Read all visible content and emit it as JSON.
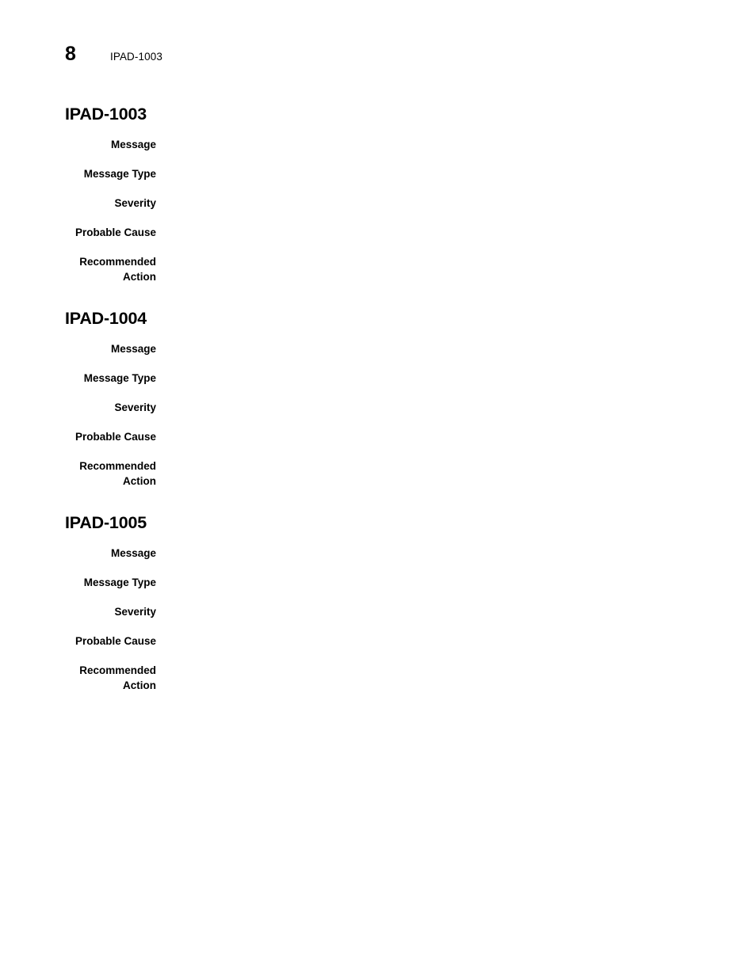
{
  "header": {
    "page_number": "8",
    "running_title": "IPAD-1003"
  },
  "sections": [
    {
      "heading": "IPAD-1003",
      "fields": [
        {
          "label": "Message",
          "value": ""
        },
        {
          "label": "Message Type",
          "value": ""
        },
        {
          "label": "Severity",
          "value": ""
        },
        {
          "label": "Probable Cause",
          "value": ""
        },
        {
          "label": "Recommended\nAction",
          "value": ""
        }
      ]
    },
    {
      "heading": "IPAD-1004",
      "fields": [
        {
          "label": "Message",
          "value": ""
        },
        {
          "label": "Message Type",
          "value": ""
        },
        {
          "label": "Severity",
          "value": ""
        },
        {
          "label": "Probable Cause",
          "value": ""
        },
        {
          "label": "Recommended\nAction",
          "value": ""
        }
      ]
    },
    {
      "heading": "IPAD-1005",
      "fields": [
        {
          "label": "Message",
          "value": ""
        },
        {
          "label": "Message Type",
          "value": ""
        },
        {
          "label": "Severity",
          "value": ""
        },
        {
          "label": "Probable Cause",
          "value": ""
        },
        {
          "label": "Recommended\nAction",
          "value": ""
        }
      ]
    }
  ]
}
